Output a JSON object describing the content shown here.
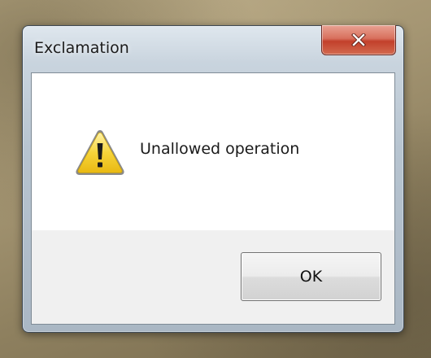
{
  "window": {
    "title": "Exclamation",
    "close_icon": "close-icon"
  },
  "dialog": {
    "icon": "warning-icon",
    "message": "Unallowed operation"
  },
  "buttons": {
    "ok_label": "OK"
  },
  "colors": {
    "close_button": "#c2402b",
    "warning_yellow": "#f4cc24",
    "footer_bg": "#f0f0f0"
  }
}
